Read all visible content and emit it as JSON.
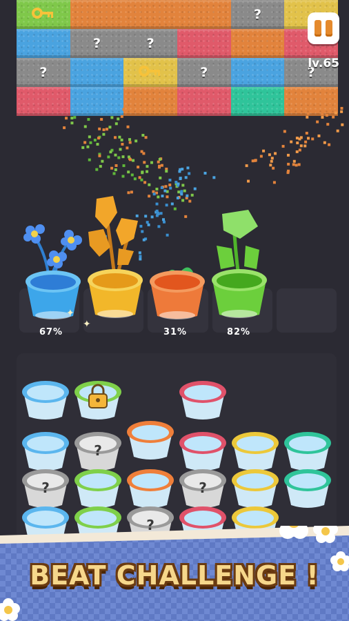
{
  "hud": {
    "level": "lv.65",
    "pause_icon": "pause-icon"
  },
  "grid": {
    "rows": [
      [
        {
          "color": "#7fc84a",
          "content": "key"
        },
        {
          "color": "#e2833c",
          "content": ""
        },
        {
          "color": "#e2833c",
          "content": ""
        },
        {
          "color": "#e2833c",
          "content": ""
        },
        {
          "color": "#8a8a8a",
          "content": "?"
        },
        {
          "color": "#e2c24a",
          "content": ""
        }
      ],
      [
        {
          "color": "#4aa3e0",
          "content": ""
        },
        {
          "color": "#8a8a8a",
          "content": "?"
        },
        {
          "color": "#8a8a8a",
          "content": "?"
        },
        {
          "color": "#e05a6a",
          "content": ""
        },
        {
          "color": "#e2833c",
          "content": ""
        },
        {
          "color": "#e05a6a",
          "content": ""
        }
      ],
      [
        {
          "color": "#8a8a8a",
          "content": "?"
        },
        {
          "color": "#4aa3e0",
          "content": ""
        },
        {
          "color": "#e2c24a",
          "content": "key"
        },
        {
          "color": "#8a8a8a",
          "content": "?"
        },
        {
          "color": "#4aa3e0",
          "content": ""
        },
        {
          "color": "#8a8a8a",
          "content": "?"
        }
      ],
      [
        {
          "color": "#e05a6a",
          "content": ""
        },
        {
          "color": "#4aa3e0",
          "content": ""
        },
        {
          "color": "#e2833c",
          "content": ""
        },
        {
          "color": "#e05a6a",
          "content": ""
        },
        {
          "color": "#2fc49a",
          "content": ""
        },
        {
          "color": "#e2833c",
          "content": ""
        }
      ]
    ]
  },
  "plants": [
    {
      "name": "blue-flower",
      "pot_color": "#3da6ea",
      "percent": "67%"
    },
    {
      "name": "yellow-flower",
      "pot_color": "#f2b72a",
      "percent": ""
    },
    {
      "name": "orange-plant",
      "pot_color": "#ee7a3a",
      "percent": "31%"
    },
    {
      "name": "green-plant",
      "pot_color": "#6ccf3c",
      "percent": "82%"
    }
  ],
  "cups": {
    "rows": [
      [
        {
          "rim": "#5bb6ee",
          "state": "open"
        },
        {
          "rim": "#7fd04a",
          "state": "locked"
        },
        null,
        {
          "rim": "#e0526a",
          "state": "open"
        },
        null,
        null
      ],
      [
        {
          "rim": "#5bb6ee",
          "state": "open"
        },
        {
          "rim": "#9a9a9a",
          "state": "hidden"
        },
        {
          "rim": "#ef7f3a",
          "state": "open"
        },
        {
          "rim": "#e0526a",
          "state": "open"
        },
        {
          "rim": "#ecc83a",
          "state": "open"
        },
        {
          "rim": "#2fc49a",
          "state": "open"
        }
      ],
      [
        {
          "rim": "#9a9a9a",
          "state": "hidden"
        },
        {
          "rim": "#7fd04a",
          "state": "open"
        },
        {
          "rim": "#ef7f3a",
          "state": "open"
        },
        {
          "rim": "#9a9a9a",
          "state": "hidden"
        },
        {
          "rim": "#ecc83a",
          "state": "open"
        },
        {
          "rim": "#2fc49a",
          "state": "open"
        }
      ],
      [
        {
          "rim": "#5bb6ee",
          "state": "open"
        },
        {
          "rim": "#7fd04a",
          "state": "open"
        },
        {
          "rim": "#9a9a9a",
          "state": "hidden"
        },
        {
          "rim": "#e0526a",
          "state": "open"
        },
        {
          "rim": "#ecc83a",
          "state": "open"
        },
        null
      ]
    ]
  },
  "banner": {
    "text": "BEAT CHALLENGE !"
  }
}
